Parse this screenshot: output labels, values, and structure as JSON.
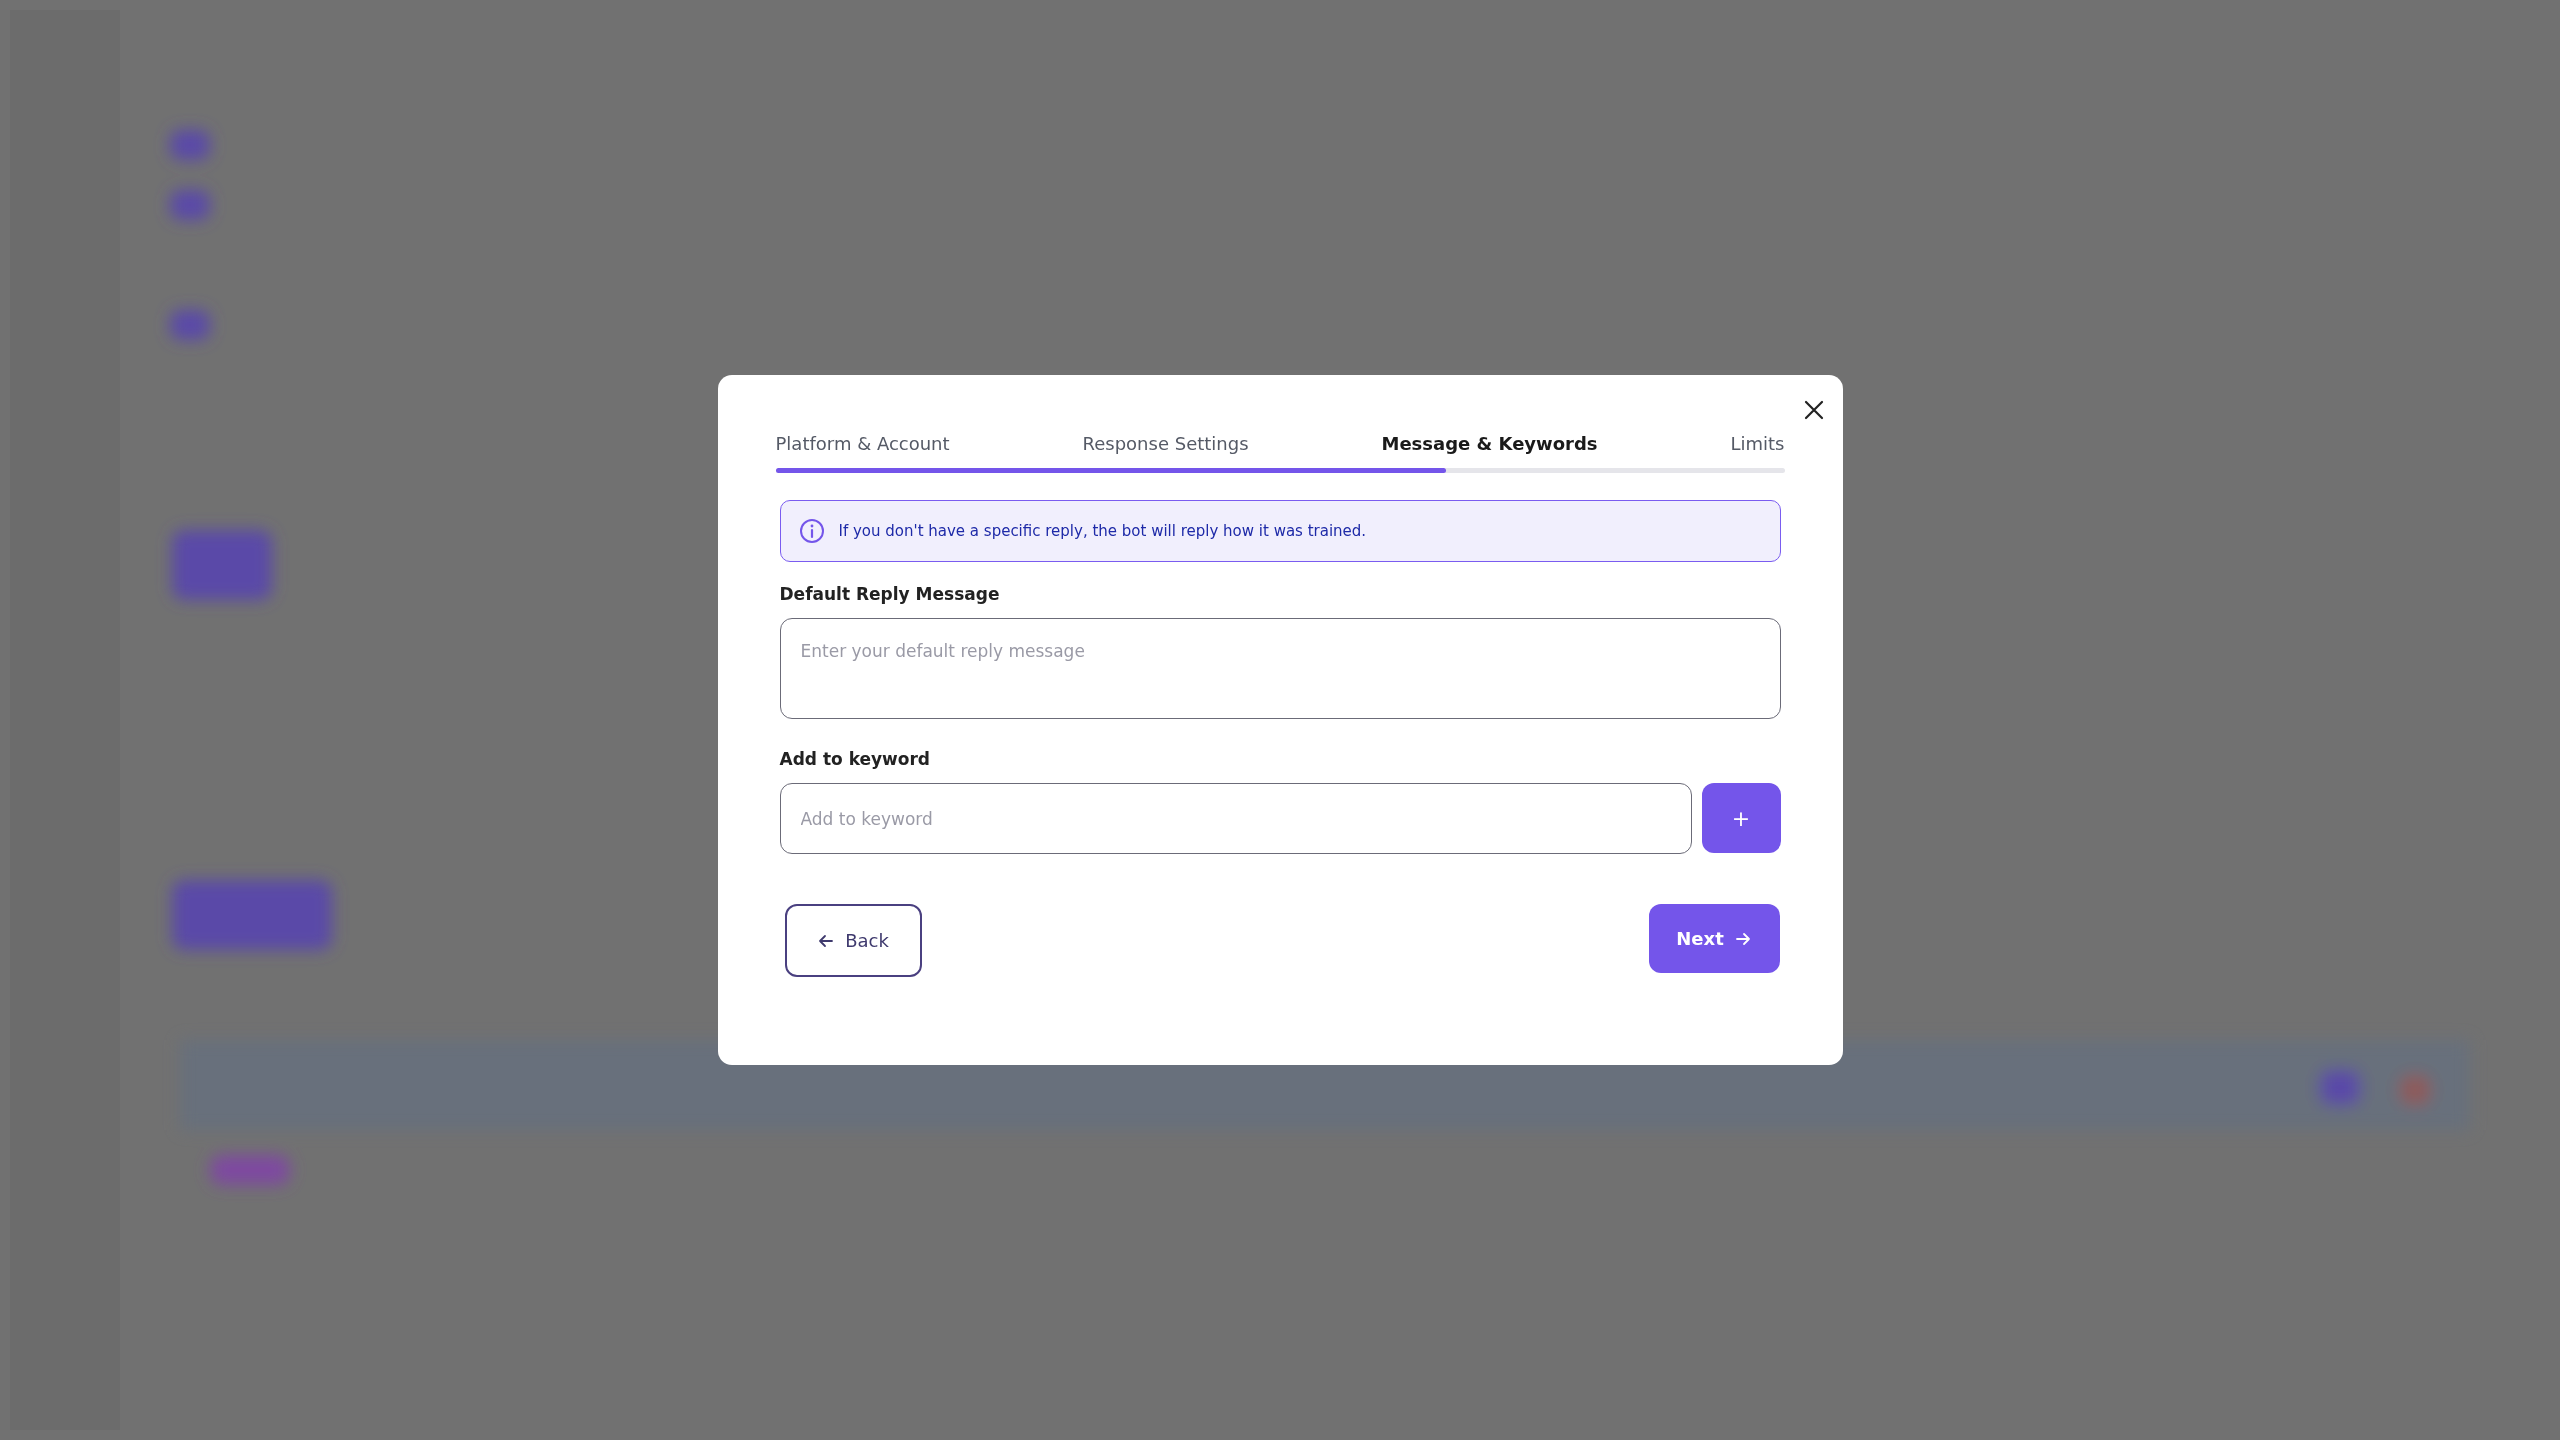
{
  "dialog": {
    "tabs": [
      {
        "label": "Platform & Account",
        "selected": false
      },
      {
        "label": "Response Settings",
        "selected": false
      },
      {
        "label": "Message & Keywords",
        "selected": true
      },
      {
        "label": "Limits",
        "selected": false
      }
    ],
    "progress": {
      "level": 0.665
    },
    "info": "If you don't have a specific reply, the bot will reply how it was trained.",
    "default_reply": {
      "label": "Default Reply Message",
      "placeholder": "Enter your default reply message"
    },
    "keyword": {
      "label": "Add to keyword",
      "placeholder": "Add to keyword",
      "add_button": "+"
    },
    "back_button": "Back",
    "next_button": "Next"
  }
}
